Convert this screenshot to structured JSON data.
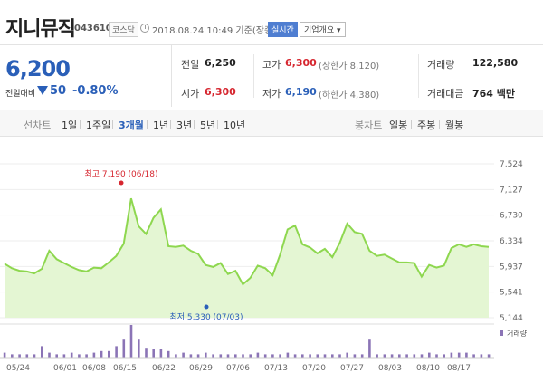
{
  "stock": {
    "name": "지니뮤직",
    "code": "043610",
    "market": "코스닥",
    "datetime": "2018.08.24 10:49 기준(장중)",
    "live_label": "실시간",
    "corp_info_label": "기업개요"
  },
  "price": {
    "current": "6,200",
    "change_label": "전일대비",
    "change": "50",
    "change_pct": "-0.80%",
    "direction": "down"
  },
  "stats": {
    "prev_close_label": "전일",
    "prev_close": "6,250",
    "high_label": "고가",
    "high": "6,300",
    "upper_limit": "(상한가 8,120)",
    "volume_label": "거래량",
    "volume": "122,580",
    "open_label": "시가",
    "open": "6,300",
    "low_label": "저가",
    "low": "6,190",
    "lower_limit": "(하한가 4,380)",
    "value_label": "거래대금",
    "value": "764 백만"
  },
  "tabs": {
    "line_label": "선차트",
    "line_items": [
      "1일",
      "1주일",
      "3개월",
      "1년",
      "3년",
      "5년",
      "10년"
    ],
    "active": "3개월",
    "candle_label": "봉차트",
    "candle_items": [
      "일봉",
      "주봉",
      "월봉"
    ]
  },
  "colors": {
    "accent": "#2a5fb8",
    "up": "#d6262f",
    "line": "#8ed74f",
    "area": "#e4f6d3",
    "volume": "#8b74b6"
  },
  "chart_data": {
    "type": "area",
    "x_ticks": [
      "05/24",
      "06/01",
      "06/08",
      "06/15",
      "06/22",
      "06/29",
      "07/06",
      "07/13",
      "07/20",
      "07/27",
      "08/03",
      "08/10",
      "08/17"
    ],
    "y_ticks": [
      "7,524",
      "7,127",
      "6,730",
      "6,334",
      "5,937",
      "5,541",
      "5,144"
    ],
    "ylim": [
      5144,
      7524
    ],
    "high_annotation": "최고 7,190 (06/18)",
    "low_annotation": "최저 5,330 (07/03)",
    "volume_label": "거래량",
    "values": [
      5980,
      5910,
      5870,
      5860,
      5830,
      5900,
      6180,
      6050,
      5990,
      5930,
      5880,
      5860,
      5920,
      5910,
      6000,
      6100,
      6290,
      6990,
      6560,
      6440,
      6690,
      6820,
      6250,
      6240,
      6260,
      6180,
      6130,
      5960,
      5930,
      5990,
      5820,
      5870,
      5660,
      5760,
      5950,
      5910,
      5800,
      6120,
      6510,
      6570,
      6280,
      6230,
      6140,
      6210,
      6080,
      6300,
      6600,
      6470,
      6440,
      6180,
      6100,
      6120,
      6060,
      6000,
      6000,
      5990,
      5780,
      5960,
      5920,
      5950,
      6220,
      6280,
      6240,
      6280,
      6250,
      6240
    ],
    "volumes": [
      0.15,
      0.1,
      0.1,
      0.1,
      0.1,
      0.35,
      0.15,
      0.1,
      0.1,
      0.15,
      0.1,
      0.1,
      0.15,
      0.2,
      0.2,
      0.35,
      0.55,
      1.0,
      0.55,
      0.3,
      0.25,
      0.25,
      0.2,
      0.1,
      0.15,
      0.1,
      0.1,
      0.15,
      0.1,
      0.1,
      0.1,
      0.1,
      0.1,
      0.1,
      0.15,
      0.1,
      0.1,
      0.1,
      0.15,
      0.1,
      0.1,
      0.1,
      0.1,
      0.1,
      0.1,
      0.1,
      0.15,
      0.1,
      0.1,
      0.55,
      0.1,
      0.1,
      0.1,
      0.1,
      0.1,
      0.1,
      0.1,
      0.15,
      0.1,
      0.1,
      0.15,
      0.15,
      0.15,
      0.1,
      0.1,
      0.1
    ]
  }
}
